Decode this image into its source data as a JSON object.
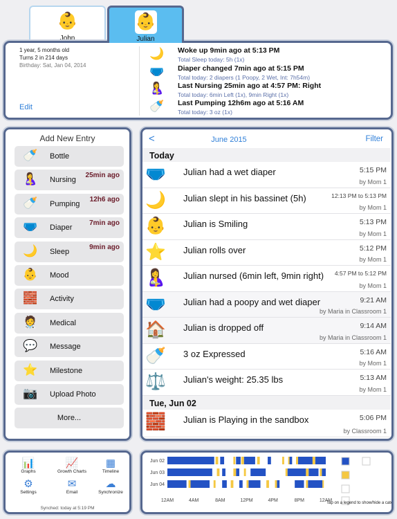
{
  "tabs": [
    {
      "name": "John",
      "icon": "baby-photo-john",
      "selected": false
    },
    {
      "name": "Julian",
      "icon": "baby-photo-julian",
      "selected": true
    }
  ],
  "profile": {
    "age": "1 year, 5 months old",
    "turns": "Turns 2 in 214 days",
    "birthday": "Birthday: Sat, Jan 04, 2014",
    "edit": "Edit"
  },
  "summary": [
    {
      "icon": "sleep-icon",
      "title": "Woke up  9min ago at 5:13 PM",
      "detail": "Total Sleep today:  5h (1x)"
    },
    {
      "icon": "diaper-icon",
      "title": "Diaper changed  7min ago at 5:15 PM",
      "detail": "Total today:  2 diapers (1 Poopy, 2 Wet, Int: 7h54m)"
    },
    {
      "icon": "nursing-icon",
      "title": "Last Nursing  25min ago at 4:57 PM: Right",
      "detail": "Total today:  6min Left (1x), 9min Right (1x)"
    },
    {
      "icon": "pumping-icon",
      "title": "Last Pumping  12h6m ago at 5:16 AM",
      "detail": "Total today:  3 oz (1x)"
    }
  ],
  "add_entry": {
    "title": "Add New Entry",
    "items": [
      {
        "label": "Bottle",
        "icon": "bottle-icon",
        "ago": ""
      },
      {
        "label": "Nursing",
        "icon": "nursing-icon",
        "ago": "25min ago"
      },
      {
        "label": "Pumping",
        "icon": "pumping-icon",
        "ago": "12h6 ago"
      },
      {
        "label": "Diaper",
        "icon": "diaper-icon",
        "ago": "7min ago"
      },
      {
        "label": "Sleep",
        "icon": "sleep-icon",
        "ago": "9min ago"
      },
      {
        "label": "Mood",
        "icon": "mood-icon",
        "ago": ""
      },
      {
        "label": "Activity",
        "icon": "activity-icon",
        "ago": ""
      },
      {
        "label": "Medical",
        "icon": "medical-icon",
        "ago": ""
      },
      {
        "label": "Message",
        "icon": "message-icon",
        "ago": ""
      },
      {
        "label": "Milestone",
        "icon": "star-icon",
        "ago": ""
      },
      {
        "label": "Upload Photo",
        "icon": "camera-icon",
        "ago": ""
      },
      {
        "label": "More...",
        "icon": "",
        "ago": ""
      }
    ]
  },
  "log": {
    "back": "<",
    "month": "June 2015",
    "filter": "Filter",
    "sections": [
      {
        "title": "Today",
        "rows": [
          {
            "icon": "diaper-icon",
            "text": "Julian had a wet diaper",
            "time": "5:15 PM",
            "by": "by Mom 1"
          },
          {
            "icon": "sleep-icon",
            "text": "Julian slept in his bassinet (5h)",
            "time": "12:13 PM to 5:13 PM",
            "by": "by Mom 1"
          },
          {
            "icon": "mood-icon",
            "text": "Julian is Smiling",
            "time": "5:13 PM",
            "by": "by Mom 1"
          },
          {
            "icon": "star-icon",
            "text": "Julian rolls over",
            "time": "5:12 PM",
            "by": "by Mom 1"
          },
          {
            "icon": "nursing-icon",
            "text": "Julian nursed (6min left, 9min right)",
            "time": "4:57 PM to 5:12 PM",
            "by": "by Mom 1"
          },
          {
            "icon": "diaper-icon",
            "text": "Julian had a poopy and wet diaper",
            "time": "9:21 AM",
            "by": "by Maria in Classroom 1"
          },
          {
            "icon": "house-icon",
            "text": "Julian is dropped off",
            "time": "9:14 AM",
            "by": "by Maria in Classroom 1"
          },
          {
            "icon": "pumping-icon",
            "text": "3 oz Expressed",
            "time": "5:16 AM",
            "by": "by Mom 1"
          },
          {
            "icon": "scale-icon",
            "text": "Julian's weight: 25.35 lbs",
            "time": "5:13 AM",
            "by": "by Mom 1"
          }
        ]
      },
      {
        "title": "Tue, Jun 02",
        "rows": [
          {
            "icon": "activity-icon",
            "text": "Julian is Playing in the sandbox",
            "time": "5:06 PM",
            "by": "by Classroom 1"
          }
        ]
      }
    ]
  },
  "tools": {
    "items": [
      "Graphs",
      "Growth Charts",
      "Timeline",
      "Settings",
      "Email",
      "Synchronize"
    ],
    "synched": "Synched: today at 5:19 PM"
  },
  "chart_data": {
    "type": "timeline",
    "categories": [
      "Jun 02",
      "Jun 03",
      "Jun 04"
    ],
    "x_ticks": [
      "12AM",
      "4AM",
      "8AM",
      "12PM",
      "4PM",
      "8PM",
      "12AM"
    ],
    "xlim": [
      0,
      24
    ],
    "colors": {
      "sleep": "#2352c4",
      "nursing": "#f5c842"
    },
    "legend_note": "Tap on a legend to show/hide a category",
    "series": [
      {
        "day": "Jun 02",
        "sleep": [
          [
            0,
            7.1
          ],
          [
            8,
            8.6
          ],
          [
            10.4,
            11.1
          ],
          [
            11.6,
            13.3
          ],
          [
            15.2,
            15.7
          ],
          [
            18.5,
            18.9
          ],
          [
            19.8,
            22
          ],
          [
            22.4,
            24
          ]
        ],
        "nursing": [
          [
            7.3,
            7.7
          ],
          [
            10,
            10.3
          ],
          [
            11.2,
            11.6
          ],
          [
            13.6,
            14
          ],
          [
            17.4,
            17.7
          ],
          [
            18.3,
            18.5
          ],
          [
            19.5,
            19.8
          ],
          [
            22,
            22.4
          ]
        ]
      },
      {
        "day": "Jun 03",
        "sleep": [
          [
            0,
            6.8
          ],
          [
            8.3,
            8.8
          ],
          [
            10.4,
            10.9
          ],
          [
            12.6,
            14.9
          ],
          [
            18.2,
            21
          ],
          [
            21.4,
            22.9
          ],
          [
            23.4,
            24
          ]
        ],
        "nursing": [
          [
            7.5,
            7.9
          ],
          [
            10,
            10.4
          ],
          [
            11.6,
            11.9
          ],
          [
            17.9,
            18.2
          ],
          [
            21,
            21.4
          ],
          [
            23.1,
            23.4
          ]
        ]
      },
      {
        "day": "Jun 04",
        "sleep": [
          [
            0,
            2.9
          ],
          [
            3.5,
            6.4
          ],
          [
            8.3,
            9
          ],
          [
            10.9,
            11.4
          ],
          [
            12.3,
            14.1
          ],
          [
            16.6,
            17
          ],
          [
            19.3,
            20.7
          ],
          [
            21.3,
            23.5
          ]
        ],
        "nursing": [
          [
            3.2,
            3.5
          ],
          [
            7,
            7.3
          ],
          [
            9.6,
            10
          ],
          [
            12,
            12.3
          ],
          [
            15,
            15.4
          ],
          [
            16.3,
            16.6
          ],
          [
            21,
            21.3
          ],
          [
            23.5,
            23.7
          ]
        ]
      }
    ]
  }
}
